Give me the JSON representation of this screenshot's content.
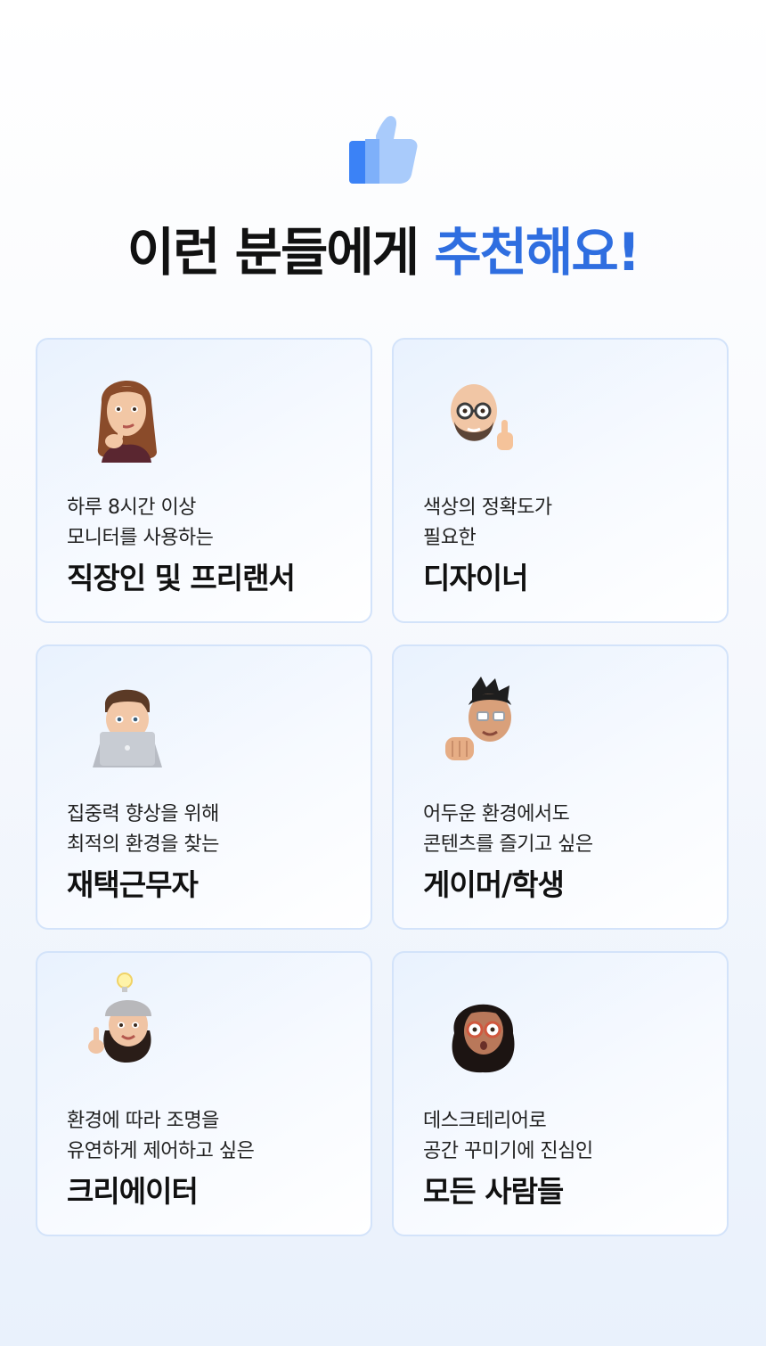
{
  "header": {
    "icon": "thumbs-up-icon",
    "headline_part1": "이런 분들에게 ",
    "headline_accent": "추천해요!",
    "accent_color": "#2f6ee0"
  },
  "cards": [
    {
      "avatar": "woman-thinking-avatar",
      "line1": "하루 8시간 이상",
      "line2": "모니터를 사용하는",
      "title": "직장인 및 프리랜서"
    },
    {
      "avatar": "bald-man-thumbs-up-avatar",
      "line1": "색상의 정확도가",
      "line2": "필요한",
      "title": "디자이너"
    },
    {
      "avatar": "man-with-laptop-avatar",
      "line1": "집중력 향상을 위해",
      "line2": "최적의 환경을 찾는",
      "title": "재택근무자"
    },
    {
      "avatar": "man-fist-bump-avatar",
      "line1": "어두운 환경에서도",
      "line2": "콘텐츠를 즐기고 싶은",
      "title": "게이머/학생"
    },
    {
      "avatar": "woman-lightbulb-avatar",
      "line1": "환경에 따라 조명을",
      "line2": "유연하게 제어하고 싶은",
      "title": "크리에이터"
    },
    {
      "avatar": "woman-glasses-surprised-avatar",
      "line1": "데스크테리어로",
      "line2": "공간 꾸미기에 진심인",
      "title": "모든 사람들"
    }
  ]
}
